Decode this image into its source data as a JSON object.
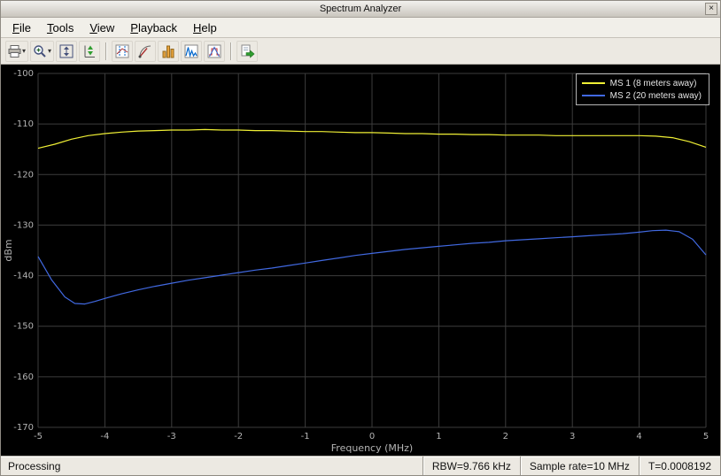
{
  "window": {
    "title": "Spectrum Analyzer",
    "close_glyph": "×"
  },
  "menu": {
    "items": [
      {
        "label": "File"
      },
      {
        "label": "Tools"
      },
      {
        "label": "View"
      },
      {
        "label": "Playback"
      },
      {
        "label": "Help"
      }
    ]
  },
  "toolbar": {
    "dropdown_glyph": "▾",
    "buttons": [
      "print",
      "zoom-in",
      "fit-to-view",
      "autoscale-y",
      "cursor-measurements",
      "signal-statistics",
      "peak-finder",
      "distortion-measurements",
      "spectral-mask",
      "step-forward"
    ]
  },
  "chart_data": {
    "type": "line",
    "title": "",
    "xlabel": "Frequency (MHz)",
    "ylabel": "dBm",
    "xlim": [
      -5,
      5
    ],
    "ylim": [
      -170,
      -100
    ],
    "xticks": [
      -5,
      -4,
      -3,
      -2,
      -1,
      0,
      1,
      2,
      3,
      4,
      5
    ],
    "yticks": [
      -170,
      -160,
      -150,
      -140,
      -130,
      -120,
      -110,
      -100
    ],
    "grid": true,
    "background": "#000000",
    "grid_color": "#3d3d3d",
    "tick_color": "#b4b4b4",
    "legend_position": "top-right",
    "series": [
      {
        "name": "MS 1 (8 meters away)",
        "color": "#efef35",
        "x": [
          -5,
          -4.75,
          -4.5,
          -4.25,
          -4,
          -3.75,
          -3.5,
          -3.25,
          -3,
          -2.75,
          -2.5,
          -2.25,
          -2,
          -1.75,
          -1.5,
          -1.25,
          -1,
          -0.75,
          -0.5,
          -0.25,
          0,
          0.25,
          0.5,
          0.75,
          1,
          1.25,
          1.5,
          1.75,
          2,
          2.25,
          2.5,
          2.75,
          3,
          3.25,
          3.5,
          3.75,
          4,
          4.25,
          4.5,
          4.75,
          5
        ],
        "y": [
          -114.8,
          -114.0,
          -113.0,
          -112.3,
          -111.9,
          -111.6,
          -111.4,
          -111.3,
          -111.2,
          -111.2,
          -111.1,
          -111.2,
          -111.2,
          -111.3,
          -111.3,
          -111.4,
          -111.5,
          -111.5,
          -111.6,
          -111.7,
          -111.7,
          -111.8,
          -111.9,
          -111.9,
          -112.0,
          -112.0,
          -112.1,
          -112.1,
          -112.2,
          -112.2,
          -112.2,
          -112.3,
          -112.3,
          -112.3,
          -112.3,
          -112.3,
          -112.3,
          -112.4,
          -112.7,
          -113.5,
          -114.6
        ]
      },
      {
        "name": "MS 2 (20 meters away)",
        "color": "#4169e1",
        "x": [
          -5,
          -4.8,
          -4.6,
          -4.45,
          -4.3,
          -4.15,
          -4,
          -3.75,
          -3.5,
          -3.25,
          -3,
          -2.75,
          -2.5,
          -2.25,
          -2,
          -1.75,
          -1.5,
          -1.25,
          -1,
          -0.75,
          -0.5,
          -0.25,
          0,
          0.25,
          0.5,
          0.75,
          1,
          1.25,
          1.5,
          1.75,
          2,
          2.25,
          2.5,
          2.75,
          3,
          3.25,
          3.5,
          3.75,
          4,
          4.2,
          4.4,
          4.6,
          4.8,
          5
        ],
        "y": [
          -136.2,
          -140.8,
          -144.2,
          -145.5,
          -145.6,
          -145.1,
          -144.5,
          -143.6,
          -142.8,
          -142.1,
          -141.5,
          -140.9,
          -140.4,
          -139.9,
          -139.4,
          -138.9,
          -138.5,
          -138.0,
          -137.5,
          -137.0,
          -136.5,
          -136.0,
          -135.6,
          -135.2,
          -134.8,
          -134.5,
          -134.2,
          -133.9,
          -133.6,
          -133.4,
          -133.1,
          -132.9,
          -132.7,
          -132.5,
          -132.3,
          -132.1,
          -131.9,
          -131.7,
          -131.4,
          -131.1,
          -131.0,
          -131.3,
          -132.8,
          -135.9
        ]
      }
    ]
  },
  "status": {
    "left": "Processing",
    "cells": [
      "RBW=9.766 kHz",
      "Sample rate=10 MHz",
      "T=0.0008192"
    ]
  }
}
